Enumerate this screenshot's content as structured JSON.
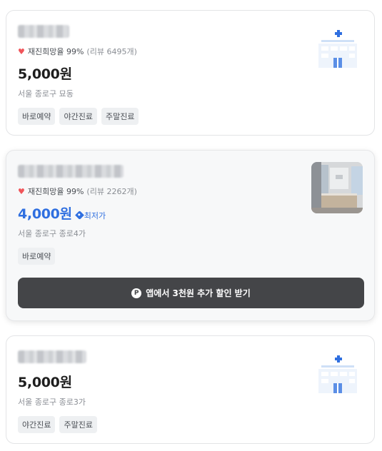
{
  "cards": [
    {
      "rating_text": "재진희망율 99%",
      "review_text": "(리뷰 6495개)",
      "price": "5,000원",
      "address": "서울 종로구 묘동",
      "tags": [
        "바로예약",
        "야간진료",
        "주말진료"
      ],
      "thumbnail": "hospital-building-icon"
    },
    {
      "rating_text": "재진희망율 99%",
      "review_text": "(리뷰 2262개)",
      "price": "4,000원",
      "badge": "최저가",
      "address": "서울 종로구 종로4가",
      "tags": [
        "바로예약"
      ],
      "thumbnail": "clinic-photo",
      "app_button": "앱에서 3천원 추가 할인 받기",
      "app_button_icon_letter": "P"
    },
    {
      "price": "5,000원",
      "address": "서울 종로구 종로3가",
      "tags": [
        "야간진료",
        "주말진료"
      ],
      "thumbnail": "hospital-building-icon"
    }
  ],
  "colors": {
    "accent_blue": "#2f6fe0",
    "heart_red": "#f0555a",
    "button_dark": "#444548",
    "tag_bg": "#eef0f2"
  }
}
